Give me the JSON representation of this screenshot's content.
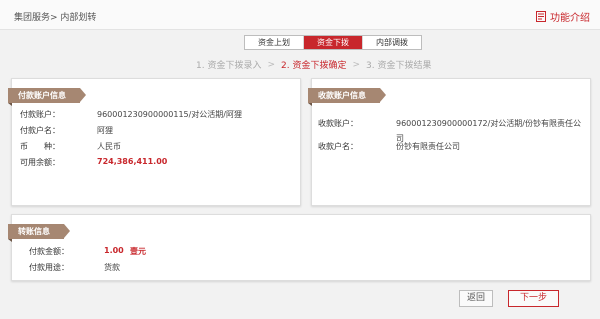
{
  "header": {
    "breadcrumb": "集团服务> 内部划转",
    "feature_intro": "功能介绍"
  },
  "tabs": [
    {
      "label": "资金上划",
      "active": false
    },
    {
      "label": "资金下拨",
      "active": true
    },
    {
      "label": "内部调拨",
      "active": false
    }
  ],
  "steps": {
    "step1": "1. 资金下拨录入",
    "step2": "2. 资金下拨确定",
    "step3": "3. 资金下拨结果",
    "sep": ">"
  },
  "payer": {
    "title": "付款账户信息",
    "account_label": "付款账户：",
    "account_value": "960001230900000115/对公活期/阿狸",
    "name_label": "付款户名：",
    "name_value": "阿狸",
    "currency_label": "币　　种：",
    "currency_value": "人民币",
    "balance_label": "可用余额：",
    "balance_value": "724,386,411.00"
  },
  "payee": {
    "title": "收款账户信息",
    "account_label": "收款账户：",
    "account_value_line1": "960001230900000172/对公活期/份钞有限责任公",
    "account_value_line2": "司",
    "name_label": "收款户名：",
    "name_value": "份钞有限责任公司"
  },
  "transfer": {
    "title": "转账信息",
    "amount_label": "付款金额：",
    "amount_value": "1.00",
    "amount_words": "壹元",
    "purpose_label": "付款用途：",
    "purpose_value": "货款"
  },
  "buttons": {
    "back": "返回",
    "next": "下一步"
  },
  "colors": {
    "accent": "#c8272c",
    "ribbon": "#a68772"
  }
}
